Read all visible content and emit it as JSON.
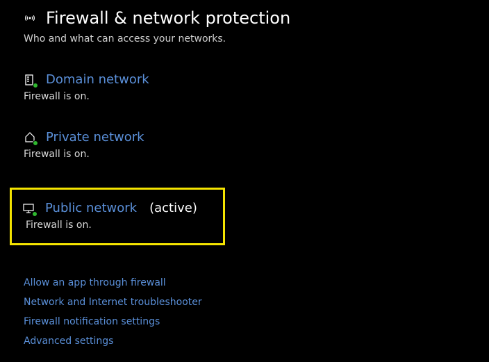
{
  "page": {
    "title": "Firewall & network protection",
    "subtitle": "Who and what can access your networks."
  },
  "networks": {
    "domain": {
      "label": "Domain network",
      "status": "Firewall is on."
    },
    "private": {
      "label": "Private network",
      "status": "Firewall is on."
    },
    "public": {
      "label": "Public network",
      "active_suffix": "(active)",
      "status": "Firewall is on."
    }
  },
  "links": {
    "allow_app": "Allow an app through firewall",
    "troubleshooter": "Network and Internet troubleshooter",
    "notifications": "Firewall notification settings",
    "advanced": "Advanced settings"
  },
  "colors": {
    "link": "#5a8fd8",
    "highlight_border": "#f5e400",
    "status_dot": "#2fb82f"
  }
}
